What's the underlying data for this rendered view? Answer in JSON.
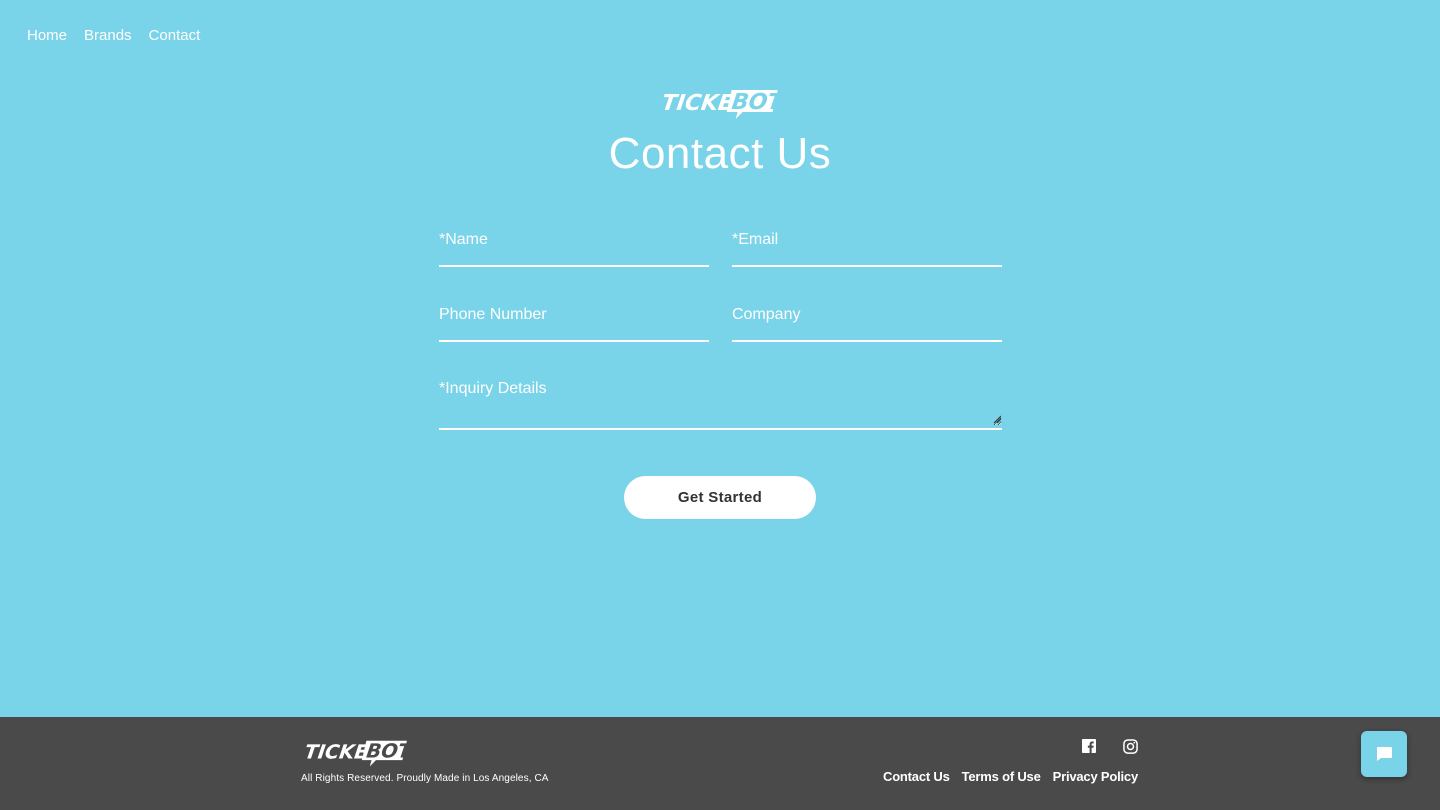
{
  "nav": {
    "items": [
      {
        "label": "Home"
      },
      {
        "label": "Brands"
      },
      {
        "label": "Contact"
      }
    ]
  },
  "brand": {
    "logo_text_a": "TICKET",
    "logo_text_b": "BOT"
  },
  "page": {
    "title": "Contact Us"
  },
  "form": {
    "name_placeholder": "*Name",
    "email_placeholder": "*Email",
    "phone_placeholder": "Phone Number",
    "company_placeholder": "Company",
    "inquiry_placeholder": "*Inquiry Details",
    "submit_label": "Get Started"
  },
  "footer": {
    "copyright": "All Rights Reserved. Proudly Made in Los Angeles, CA",
    "social": [
      {
        "icon": "facebook-icon"
      },
      {
        "icon": "instagram-icon"
      }
    ],
    "links": [
      {
        "label": "Contact Us"
      },
      {
        "label": "Terms of Use"
      },
      {
        "label": "Privacy Policy"
      }
    ]
  },
  "chat": {
    "icon": "chat-bubble-icon"
  },
  "colors": {
    "background": "#79d3e9",
    "footer": "#4a4a4a",
    "text": "#ffffff"
  }
}
